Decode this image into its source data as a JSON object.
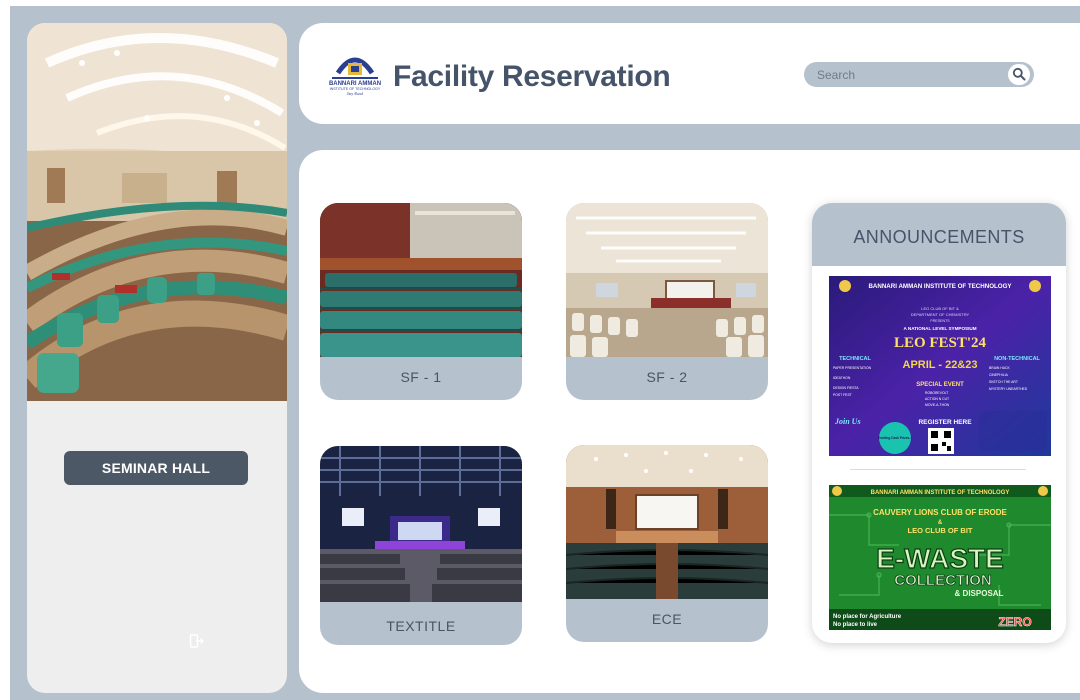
{
  "app": {
    "title": "Facility Reservation",
    "logo": {
      "name": "BANNARI AMMAN",
      "subtitle": "INSTITUTE OF TECHNOLOGY",
      "tagline": "Stay Ahead"
    }
  },
  "search": {
    "placeholder": "Search",
    "value": ""
  },
  "sidebar": {
    "button_label": "SEMINAR HALL",
    "logout_icon": "logout-icon"
  },
  "facilities": [
    {
      "label": "SF - 1"
    },
    {
      "label": "SF - 2"
    },
    {
      "label": "TEXTITLE"
    },
    {
      "label": "ECE"
    }
  ],
  "announcements": {
    "title": "ANNOUNCEMENTS",
    "posters": [
      {
        "institute": "BANNARI AMMAN INSTITUTE OF TECHNOLOGY",
        "club": "LEO CLUB OF BIT &",
        "dept": "DEPARTMENT OF CHEMISTRY",
        "presents": "PRESENTS",
        "subtitle": "A NATIONAL LEVEL SYMPOSIUM",
        "event": "LEO FEST'24",
        "date": "APRIL - 22&23",
        "technical": "TECHNICAL",
        "technical_items": [
          "PAPER PRESENTATION",
          "IDEATHON",
          "DESIGN FIESTA",
          "POST FEST"
        ],
        "non_technical": "NON-TECHNICAL",
        "non_technical_items": [
          "BRAIN HACK",
          "CINEPHILIA",
          "SKETCH THE ART",
          "MYSTERY UNEARTHED"
        ],
        "special_title": "SPECIAL EVENT",
        "special_items": [
          "ROBOREVOLT",
          "ACTION N CUT",
          "MOVE-A-THON"
        ],
        "register": "REGISTER HERE",
        "join": "Join Us",
        "prize": "Exciting Cash Prizes..!"
      },
      {
        "institute": "BANNARI AMMAN INSTITUTE OF TECHNOLOGY",
        "line1": "CAUVERY LIONS CLUB OF ERODE",
        "line2": "&",
        "line3": "LEO CLUB OF BIT",
        "headline": "E-WASTE",
        "headline2": "COLLECTION",
        "headline3": "& DISPOSAL",
        "footer1": "No place for Agriculture",
        "footer2": "No place to live",
        "target": "ZERO"
      }
    ]
  },
  "colors": {
    "frame": "#b5c1cd",
    "button": "#4c5866",
    "title": "#46546a",
    "poster1_bg": "#3b1f8f",
    "poster2_bg": "#1f8a2d"
  }
}
